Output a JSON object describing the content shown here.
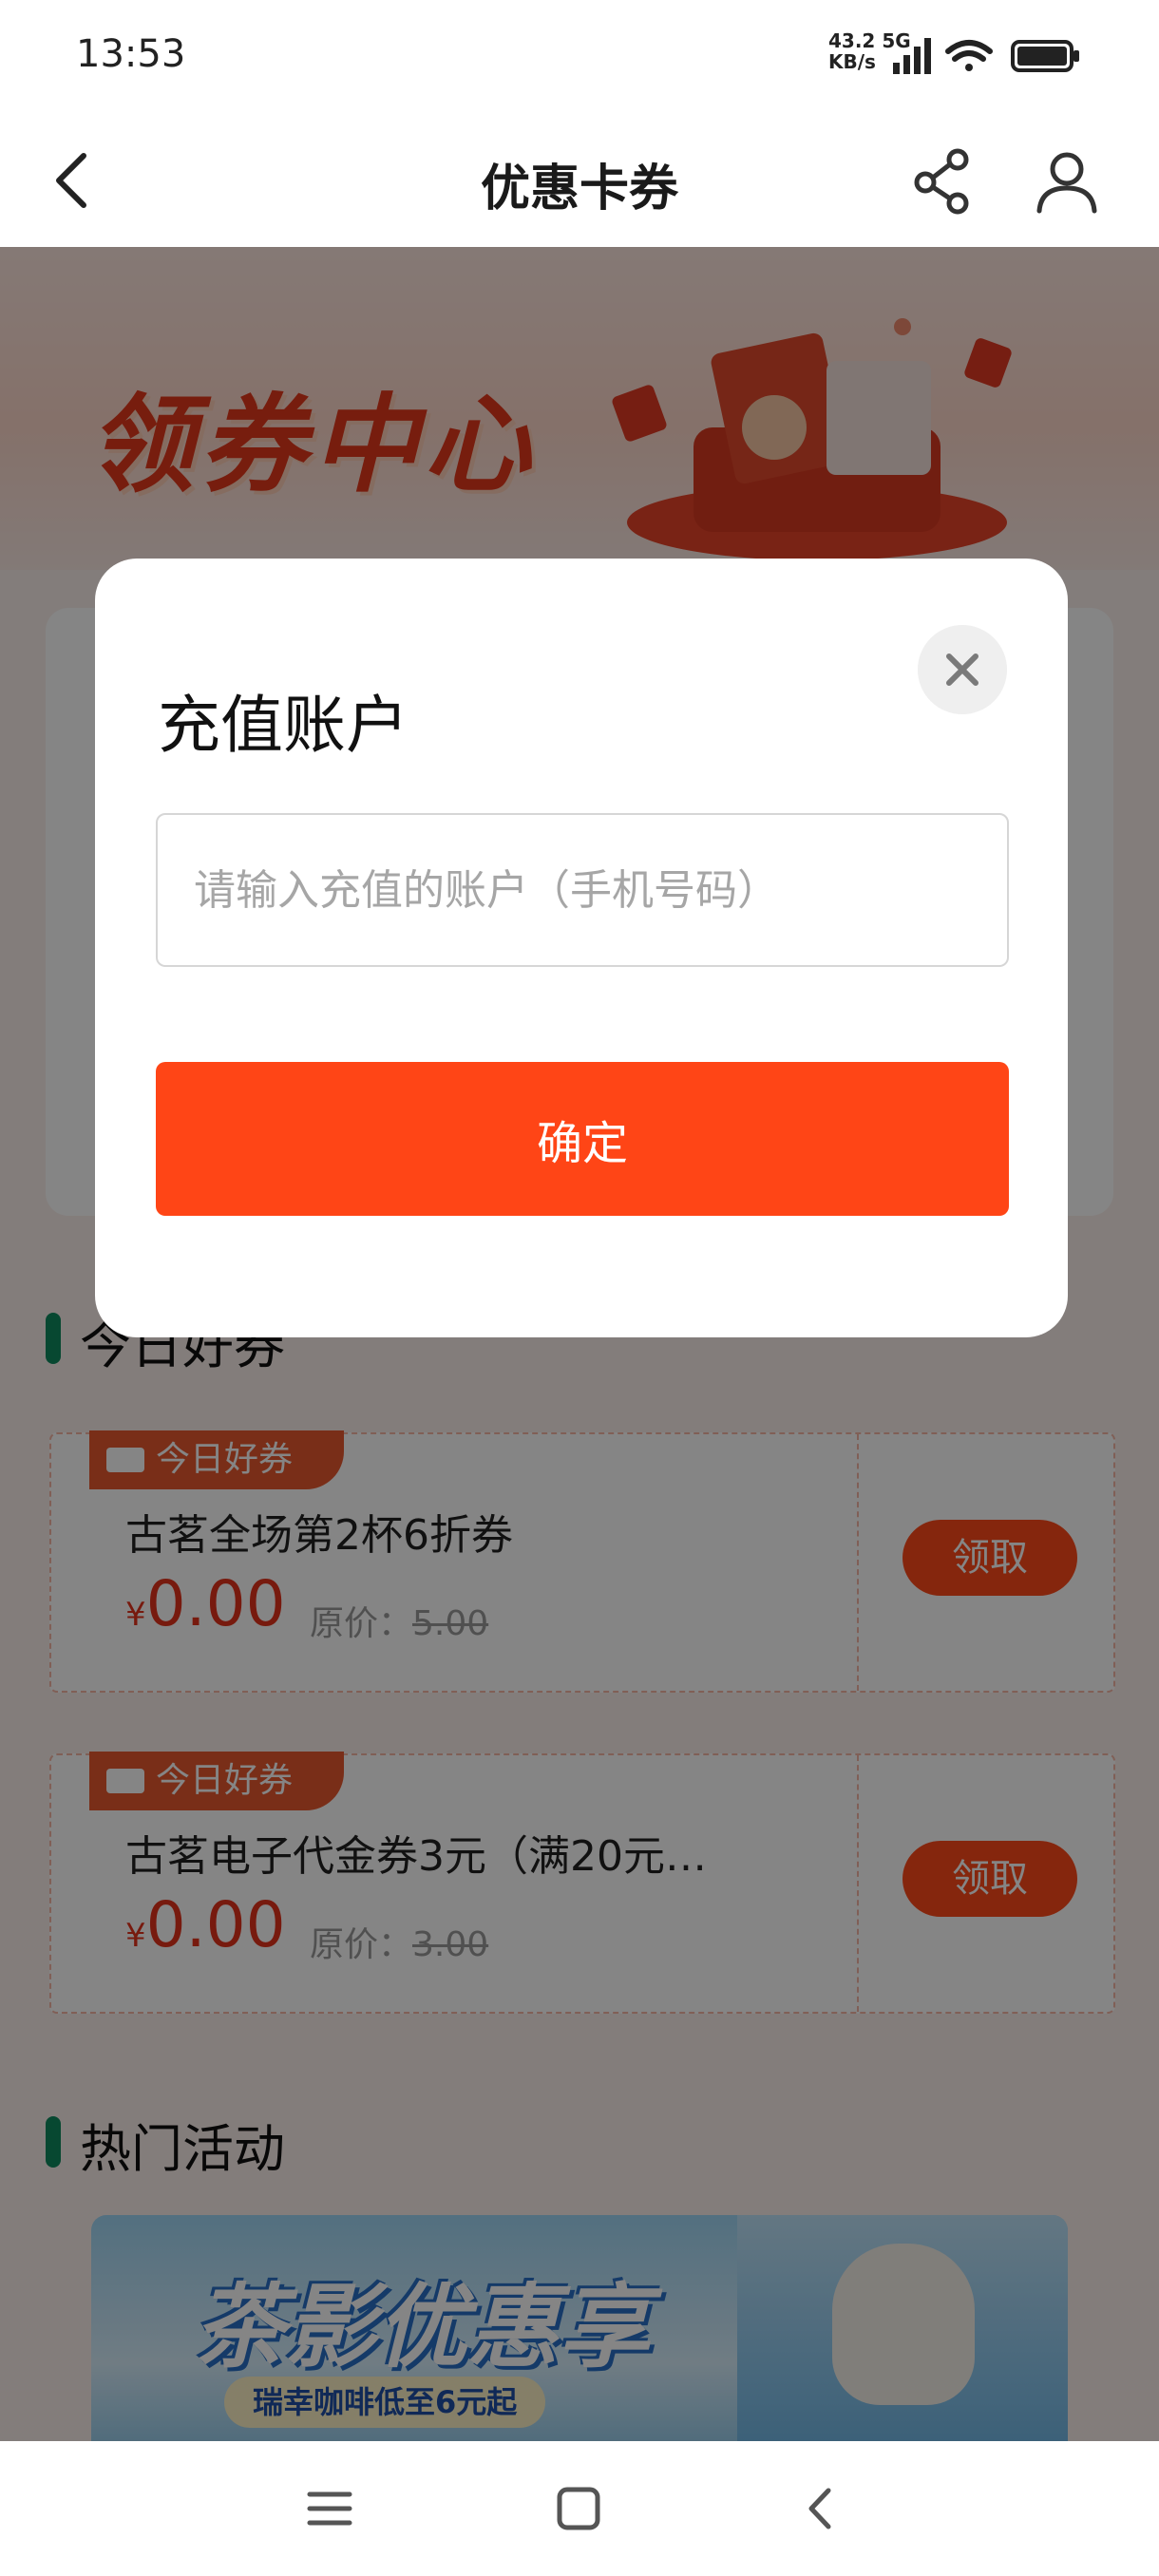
{
  "status_bar": {
    "time": "13:53",
    "net_speed": "43.2",
    "net_unit": "KB/s",
    "net_type": "5G",
    "icons": [
      "signal-icon",
      "wifi-icon",
      "battery-icon"
    ]
  },
  "nav": {
    "title": "优惠卡券",
    "icons": [
      "back-arrow-icon",
      "share-icon",
      "user-icon"
    ]
  },
  "banner": {
    "title": "领券中心"
  },
  "sections": {
    "today": "今日好券",
    "hot": "热门活动"
  },
  "coupons": [
    {
      "tag": "今日好券",
      "name": "古茗全场第2杯6折券",
      "currency": "¥",
      "price": "0.00",
      "orig_label": "原价：",
      "orig_price": "5.00",
      "button": "领取"
    },
    {
      "tag": "今日好券",
      "name": "古茗电子代金券3元（满20元…",
      "currency": "¥",
      "price": "0.00",
      "orig_label": "原价：",
      "orig_price": "3.00",
      "button": "领取"
    }
  ],
  "promo": {
    "title": "茶影优惠享",
    "subtitle": "瑞幸咖啡低至6元起"
  },
  "dialog": {
    "title": "充值账户",
    "input_placeholder": "请输入充值的账户（手机号码）",
    "input_value": "",
    "confirm": "确定"
  },
  "colors": {
    "accent": "#ff4516",
    "price_red": "#e5321b",
    "section_bar": "#0e8a5f"
  },
  "system_nav": [
    "menu-icon",
    "home-icon",
    "back-icon"
  ]
}
